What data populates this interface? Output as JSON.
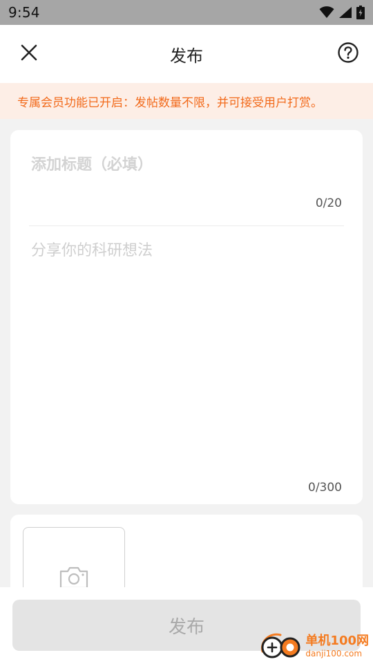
{
  "status_bar": {
    "time": "9:54",
    "icons": [
      "wifi-icon",
      "signal-icon",
      "battery-icon"
    ]
  },
  "header": {
    "title": "发布",
    "close_icon": "close-icon",
    "help_icon": "help-icon"
  },
  "notice": {
    "text": "专属会员功能已开启：发帖数量不限，并可接受用户打赏。",
    "color": "#f26a1b",
    "background": "#fdeee6"
  },
  "editor": {
    "title_placeholder": "添加标题（必填）",
    "title_count": "0/20",
    "content_placeholder": "分享你的科研想法",
    "content_count": "0/300"
  },
  "media": {
    "add_photo_icon": "camera-icon"
  },
  "footer": {
    "publish_label": "发布"
  },
  "watermark": {
    "name": "单机100网",
    "url": "danji100.com",
    "color": "#f47b20"
  }
}
